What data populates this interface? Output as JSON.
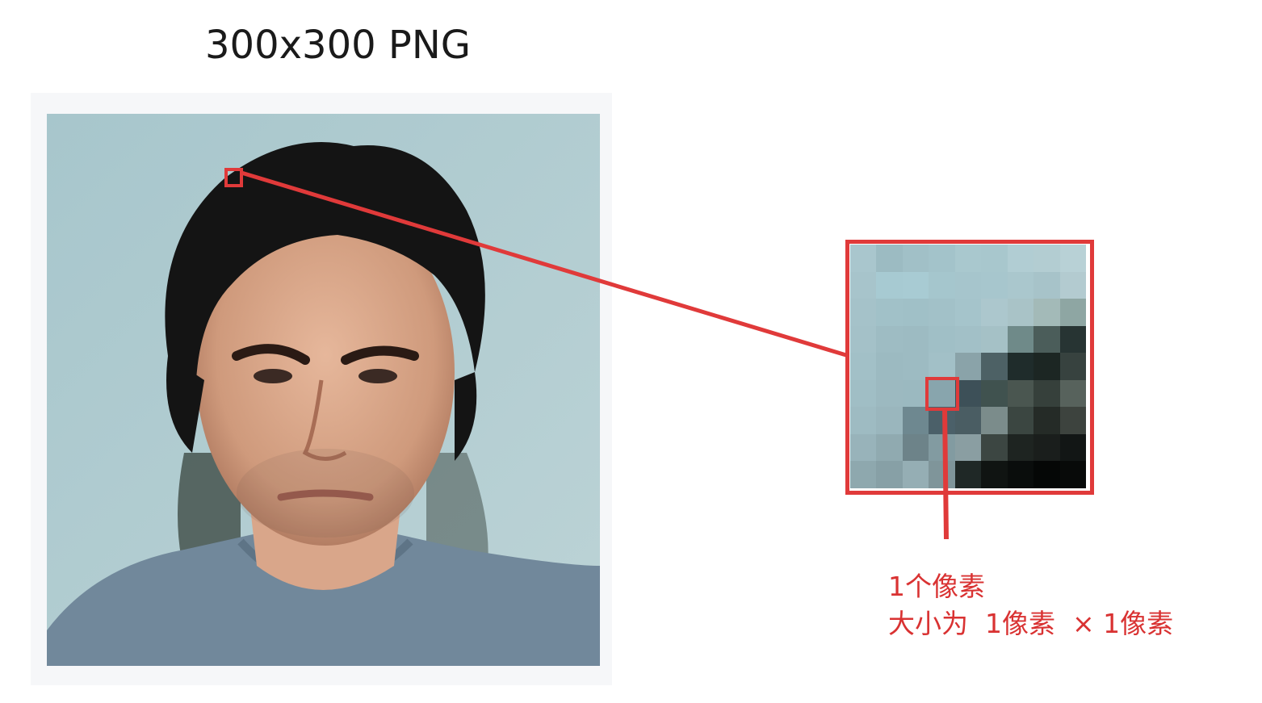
{
  "title": "300x300 PNG",
  "caption": {
    "line1": "1个像素",
    "line2": "大小为  1像素  × 1像素"
  },
  "colors": {
    "accent": "#e03a3a",
    "caption": "#d93232",
    "background": "#9fc1ca"
  },
  "zoom_pixels": [
    [
      "#a9c6cd",
      "#9cbbc2",
      "#a1c0c7",
      "#a3c3ca",
      "#a9c8ce",
      "#a8c7cd",
      "#b1cdd3",
      "#b3cdd2",
      "#b8d1d6"
    ],
    [
      "#a7c4cb",
      "#a7cad2",
      "#a8cbd3",
      "#a5c6cd",
      "#a6c5cc",
      "#a7c6cd",
      "#aac7cd",
      "#a7c3c9",
      "#b3cbd0"
    ],
    [
      "#a5c2c9",
      "#a1c1c8",
      "#a0c0c7",
      "#a2c1c8",
      "#a5c4cb",
      "#acc7cd",
      "#a9c3c7",
      "#a3bab8",
      "#8ea6a3"
    ],
    [
      "#a4c1c8",
      "#9ebcc3",
      "#9dbbc2",
      "#a0bfc6",
      "#a2c0c7",
      "#a5c1c6",
      "#6f8a89",
      "#4b5d5a",
      "#273433"
    ],
    [
      "#a2c0c7",
      "#9cbac1",
      "#9dbbc2",
      "#a2c0c7",
      "#8aa3a9",
      "#4d6165",
      "#1f2c2b",
      "#1c2623",
      "#37423f"
    ],
    [
      "#a0bec5",
      "#9cb9c0",
      "#9bb9c0",
      "#88a5ad",
      "#3d5058",
      "#40524f",
      "#4a5650",
      "#36403b",
      "#57625c"
    ],
    [
      "#9ebbc2",
      "#9ab6bd",
      "#6e8890",
      "#4b6069",
      "#4a5d63",
      "#7b8c8b",
      "#3b4641",
      "#252b27",
      "#3d433e"
    ],
    [
      "#98b3ba",
      "#90aab0",
      "#6d8389",
      "#829ba1",
      "#8a9ea2",
      "#3c4642",
      "#1e2421",
      "#1a1e1c",
      "#121615"
    ],
    [
      "#8ea8ae",
      "#87a0a6",
      "#95aeb4",
      "#7f959a",
      "#1f2826",
      "#101412",
      "#0a0d0c",
      "#050706",
      "#080a09"
    ]
  ]
}
